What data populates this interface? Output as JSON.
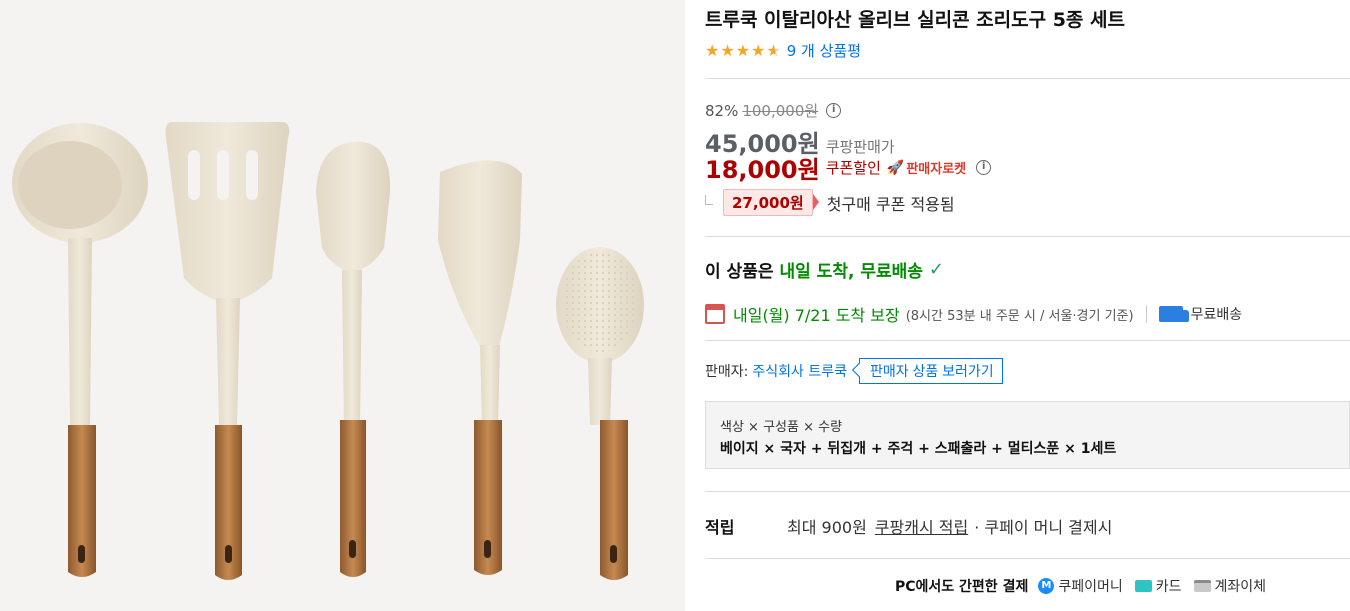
{
  "product": {
    "title": "트루쿡 이탈리아산 올리브 실리콘 조리도구 5종 세트",
    "rating": 4.5,
    "review_text": "9 개 상품평"
  },
  "price": {
    "discount_rate": "82%",
    "original_price": "100,000원",
    "sale_price": "45,000원",
    "sale_label": "쿠팡판매가",
    "coupon_price": "18,000원",
    "coupon_label": "쿠폰할인",
    "rocket_badge": "판매자로켓",
    "first_coupon_amount": "27,000원",
    "first_coupon_text": "첫구매 쿠폰 적용됨"
  },
  "delivery": {
    "head_prefix": "이 상품은",
    "head_highlight": "내일 도착, 무료배송",
    "arrival_main": "내일(월) 7/21 도착 보장",
    "arrival_sub": "(8시간 53분 내 주문 시 / 서울·경기 기준)",
    "free_shipping": "무료배송"
  },
  "seller": {
    "label": "판매자:",
    "name": "주식회사 트루쿡",
    "button": "판매자 상품 보러가기"
  },
  "option": {
    "label": "색상 × 구성품 × 수량",
    "value": "베이지 × 국자 + 뒤집개 + 주걱 + 스패출라 + 멀티스푼 × 1세트"
  },
  "points": {
    "title": "적립",
    "prefix": "최대 900원",
    "link": "쿠팡캐시 적립",
    "suffix": "· 쿠페이 머니 결제시"
  },
  "payment": {
    "title": "PC에서도 간편한 결제",
    "methods": [
      "쿠페이머니",
      "카드",
      "계좌이체"
    ]
  },
  "colors": {
    "coupon_red": "#ae0000",
    "delivery_green": "#008c00",
    "link_blue": "#0073e9",
    "star": "#f5a623",
    "silicone_beige": "#ece4d2",
    "wood": "#b77a45"
  },
  "icons": {
    "info": "info-circle-icon",
    "rocket": "rocket-icon",
    "check": "check-icon",
    "calendar": "calendar-icon",
    "truck": "truck-icon",
    "coupay": "coupay-money-icon",
    "card": "card-icon",
    "bank": "bank-transfer-icon"
  }
}
